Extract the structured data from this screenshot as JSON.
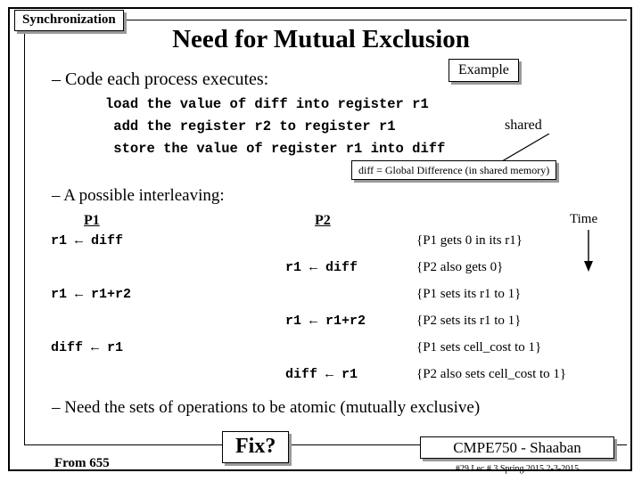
{
  "slide": {
    "tag": "Synchronization",
    "title": "Need for Mutual Exclusion",
    "example_tag": "Example",
    "bullet_code_intro": "–  Code each process executes:",
    "code_lines": [
      "load the value of diff into register r1",
      " add the register r2 to register r1",
      " store the value of register r1 into diff"
    ],
    "shared_label": "shared",
    "diff_note": "diff = Global Difference (in shared memory)",
    "bullet_interleaving": "–  A possible interleaving:",
    "col_p1": "P1",
    "col_p2": "P2",
    "time_label": "Time",
    "rows": [
      {
        "p1": "r1 ← diff",
        "p2": "",
        "comment": "{P1 gets 0 in its r1}"
      },
      {
        "p1": "",
        "p2": "r1 ← diff",
        "comment": "{P2 also gets 0}"
      },
      {
        "p1": "r1 ← r1+r2",
        "p2": "",
        "comment": "{P1 sets its r1 to 1}"
      },
      {
        "p1": "",
        "p2": "r1 ← r1+r2",
        "comment": "{P2 sets its r1 to 1}"
      },
      {
        "p1": "diff ← r1",
        "p2": "",
        "comment": "{P1 sets cell_cost to 1}"
      },
      {
        "p1": "",
        "p2": "diff ← r1",
        "comment": "{P2 also sets cell_cost to 1}"
      }
    ],
    "bullet_atomic": "–  Need the sets of operations to be atomic (mutually exclusive)",
    "fix_tag": "Fix?",
    "from_label": "From 655",
    "footer_title": "CMPE750 - Shaaban",
    "footer_sub": "#29   Lec # 3   Spring 2015  2-3-2015"
  }
}
